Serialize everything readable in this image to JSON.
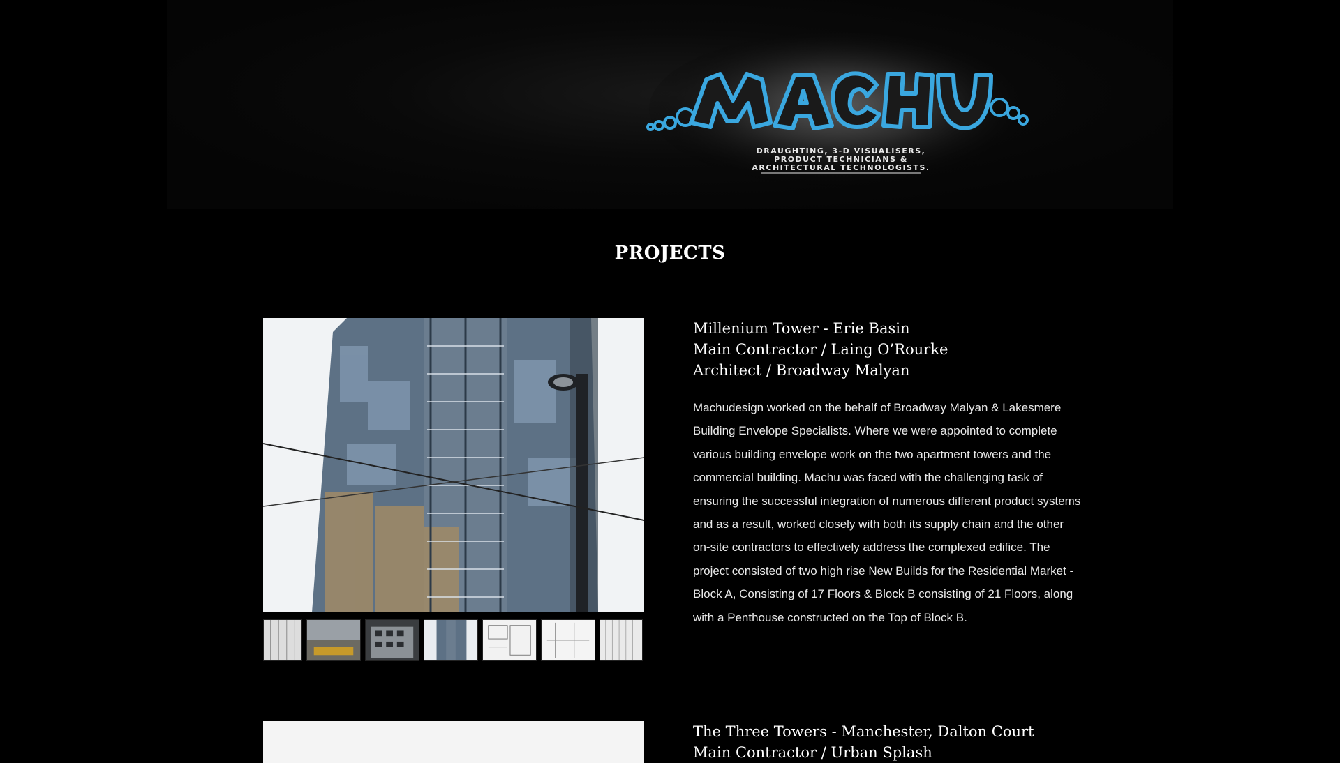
{
  "brand": {
    "logo_text": "MACHU",
    "tagline": [
      "DRAUGHTING, 3-D VISUALISERS,",
      "PRODUCT TECHNICIANS &",
      "ARCHITECTURAL TECHNOLOGISTS."
    ],
    "accent_color": "#3aa7df"
  },
  "page": {
    "title": "PROJECTS"
  },
  "projects": [
    {
      "title_lines": [
        "Millenium Tower - Erie Basin",
        "Main Contractor / Laing O’Rourke",
        "Architect / Broadway Malyan"
      ],
      "description": "Machudesign worked on the behalf of Broadway Malyan & Lakesmere Building Envelope Specialists. Where we were appointed to complete various building envelope work on the two apartment towers and the commercial building. Machu was faced with the challenging task of ensuring the successful integration of numerous different product systems and as a result, worked closely with both its supply chain and the other on-site contractors to effectively address the complexed edifice. The project consisted of two high rise New Builds for the Residential Market - Block A, Consisting of 17 Floors & Block B consisting of 21 Floors, along with a Penthouse constructed on the Top of Block B.",
      "thumbnails": [
        "drawing-thumb",
        "site-thumb",
        "building-thumb",
        "tower-thumb",
        "plan-thumb",
        "section-thumb",
        "elevation-thumb"
      ]
    },
    {
      "title_lines": [
        "The Three Towers - Manchester, Dalton Court",
        "Main Contractor / Urban Splash"
      ]
    }
  ]
}
